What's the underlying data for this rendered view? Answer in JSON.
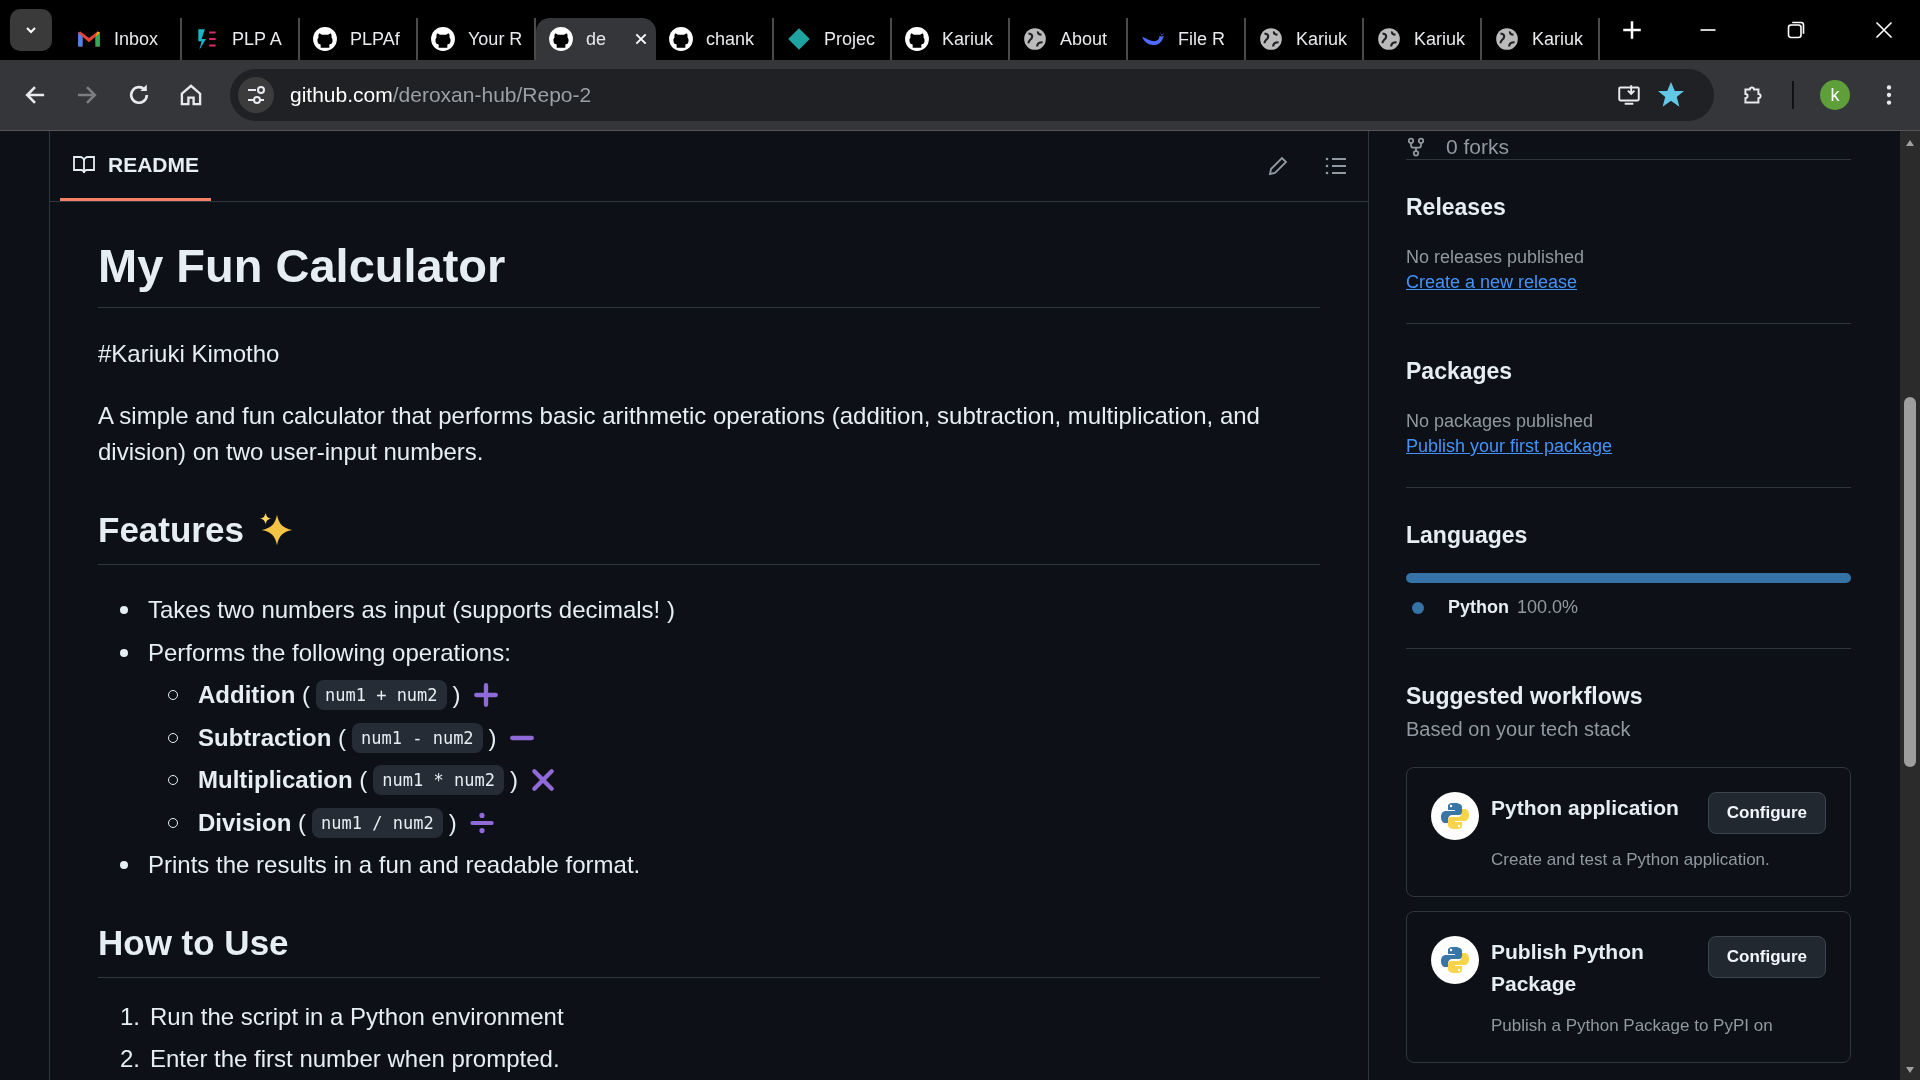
{
  "browser": {
    "tabs": [
      {
        "label": "Inbox",
        "kind": "mail",
        "selected": false
      },
      {
        "label": "PLP A",
        "kind": "brand",
        "selected": false
      },
      {
        "label": "PLPAf",
        "kind": "repo",
        "selected": false
      },
      {
        "label": "Your R",
        "kind": "repo",
        "selected": false
      },
      {
        "label": "de",
        "kind": "repo",
        "selected": true
      },
      {
        "label": "chank",
        "kind": "repo",
        "selected": false
      },
      {
        "label": "Projec",
        "kind": "diamond",
        "selected": false
      },
      {
        "label": "Kariuk",
        "kind": "repo",
        "selected": false
      },
      {
        "label": "About",
        "kind": "web",
        "selected": false
      },
      {
        "label": "File R",
        "kind": "chat",
        "selected": false
      },
      {
        "label": "Kariuk",
        "kind": "web",
        "selected": false
      },
      {
        "label": "Kariuk",
        "kind": "web",
        "selected": false
      },
      {
        "label": "Kariuk",
        "kind": "web",
        "selected": false
      }
    ],
    "address": {
      "host": "github.com",
      "path": "/deroxan-hub/Repo-2"
    },
    "bookmarked": true,
    "profile": "k"
  },
  "readme": {
    "tab": "README",
    "title": "My Fun Calculator",
    "author": "#Kariuki Kimotho",
    "intro": "A simple and fun calculator that performs basic arithmetic operations (addition, subtraction, multiplication, and division) on two user-input numbers.",
    "features_heading": "Features",
    "features": [
      {
        "text": "Takes two numbers as input (supports decimals! )"
      },
      {
        "text": "Performs the following operations:",
        "children": [
          {
            "label": "**Addition** (",
            "code": "num1 + num2",
            "close": ")",
            "kind": "plus"
          },
          {
            "label": "**Subtraction** (",
            "code": "num1 - num2",
            "close": ")",
            "kind": "minus"
          },
          {
            "label": "**Multiplication** (",
            "code": "num1 * num2",
            "close": ")",
            "kind": "times"
          },
          {
            "label": "**Division** (",
            "code": "num1 / num2",
            "close": ")",
            "kind": "divide"
          }
        ]
      },
      {
        "text": "Prints the results in a fun and readable format."
      }
    ],
    "usage_heading": "How to Use",
    "steps": [
      {
        "number": "1.",
        "text": "Run the script in a Python environment"
      },
      {
        "number": "2.",
        "text": "Enter the first number when prompted."
      }
    ]
  },
  "sidebar": {
    "forks": "0 forks",
    "sections": [
      {
        "title": "Releases",
        "note": "No releases published",
        "link": "Create a new release"
      },
      {
        "title": "Packages",
        "note": "No packages published",
        "link": "Publish your first package"
      }
    ],
    "languages": {
      "title": "Languages",
      "items": [
        {
          "name": "Python",
          "percent": "100.0%",
          "level": 1.0,
          "color": "#3572a5"
        }
      ]
    },
    "workflows": {
      "title": "Suggested workflows",
      "subtitle": "Based on your tech stack",
      "items": [
        {
          "name": "Python application",
          "description": "Create and test a Python application.",
          "button": "Configure"
        },
        {
          "name": "Publish Python Package",
          "description": "Publish a Python Package to PyPI on",
          "button": "Configure"
        }
      ]
    }
  }
}
